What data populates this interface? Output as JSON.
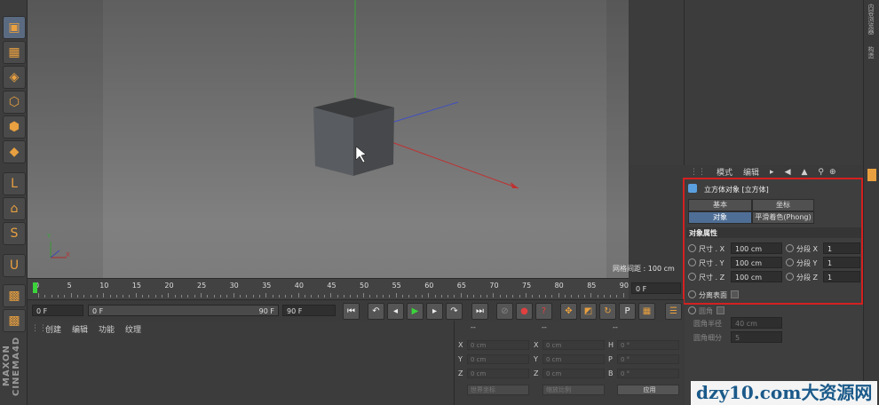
{
  "viewport": {
    "corner_text": "",
    "grid_spacing": "网格间距 : 100 cm",
    "axis_y_label": "Y",
    "axis_x_label": "X"
  },
  "right_strip": {
    "tab1": "内容浏览器",
    "tab2": "构造"
  },
  "attributes": {
    "menu": [
      "模式",
      "编辑"
    ],
    "object_title": "立方体对象 [立方体]",
    "tabs": [
      {
        "label": "基本",
        "selected": false
      },
      {
        "label": "坐标",
        "selected": false
      },
      {
        "label": "对象",
        "selected": true
      },
      {
        "label": "平滑着色(Phong)",
        "selected": false
      }
    ],
    "section_title": "对象属性",
    "rows": [
      {
        "size_label": "尺寸 . X",
        "size_value": "100 cm",
        "seg_label": "分段 X",
        "seg_value": "1"
      },
      {
        "size_label": "尺寸 . Y",
        "size_value": "100 cm",
        "seg_label": "分段 Y",
        "seg_value": "1"
      },
      {
        "size_label": "尺寸 . Z",
        "size_value": "100 cm",
        "seg_label": "分段 Z",
        "seg_value": "1"
      }
    ],
    "separate_surfaces": "分离表面",
    "fillet": "圆角",
    "fillet_radius_label": "圆角半径",
    "fillet_radius_value": "40 cm",
    "fillet_subdiv_label": "圆角细分",
    "fillet_subdiv_value": "5"
  },
  "timeline": {
    "ticks": [
      "0",
      "5",
      "10",
      "15",
      "20",
      "25",
      "30",
      "35",
      "40",
      "45",
      "50",
      "55",
      "60",
      "65",
      "70",
      "75",
      "80",
      "85",
      "90"
    ],
    "current_frame": "0 F"
  },
  "transport": {
    "start_frame": "0 F",
    "range_start": "0 F",
    "range_end": "90 F",
    "end_frame": "90 F"
  },
  "material_manager": {
    "menu": [
      "创建",
      "编辑",
      "功能",
      "纹理"
    ]
  },
  "coordinates": {
    "header": [
      "--",
      "--",
      "--"
    ],
    "rows": [
      {
        "a": "X",
        "av": "0 cm",
        "b": "X",
        "bv": "0 cm",
        "c": "H",
        "cv": "0 °"
      },
      {
        "a": "Y",
        "av": "0 cm",
        "b": "Y",
        "bv": "0 cm",
        "c": "P",
        "cv": "0 °"
      },
      {
        "a": "Z",
        "av": "0 cm",
        "b": "Z",
        "bv": "0 cm",
        "c": "B",
        "cv": "0 °"
      }
    ],
    "world_coord": "世界坐标",
    "scale_mode": "缩放比例",
    "apply": "应用"
  },
  "watermark": "dzy10.com大资源网",
  "logo": "MAXON CINEMA4D",
  "colors": {
    "highlight_box": "#d42020",
    "selected_tab": "#4f6e95",
    "playhead": "#3bd43b"
  }
}
